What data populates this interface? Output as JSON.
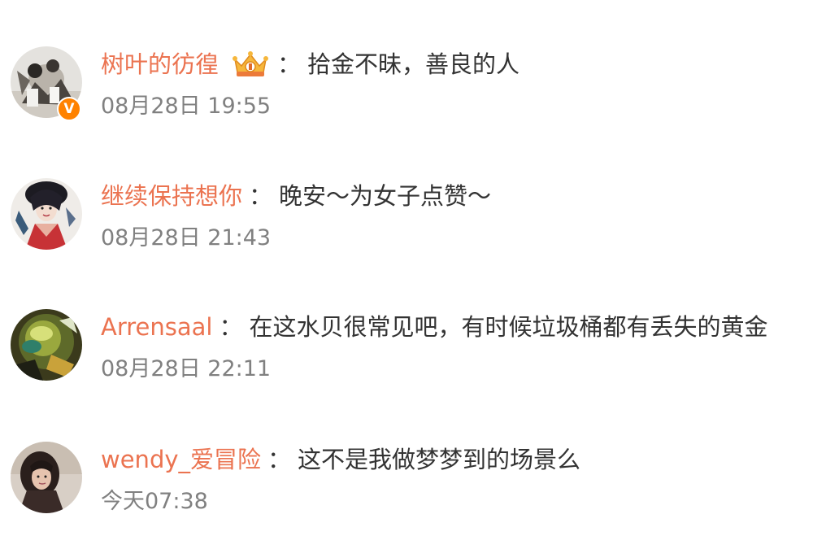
{
  "comments": [
    {
      "username": "树叶的彷徨",
      "colon": "：",
      "text": "拾金不昧，善良的人",
      "time": "08月28日 19:55",
      "verified_badge": "V",
      "verified_icon": "verified-v-icon",
      "member_icon": "crown-member-icon"
    },
    {
      "username": "继续保持想你",
      "colon": "：",
      "text": "晚安～为女子点赞～",
      "time": "08月28日 21:43"
    },
    {
      "username": "Arrensaal",
      "colon": "：",
      "text": "在这水贝很常见吧，有时候垃圾桶都有丢失的黄金",
      "time": "08月28日 22:11"
    },
    {
      "username": "wendy_爱冒险",
      "colon": "：",
      "text": "这不是我做梦梦到的场景么",
      "time": "今天07:38"
    }
  ],
  "colors": {
    "username": "#eb7350",
    "text": "#333333",
    "time": "#808080",
    "verified": "#ff8200"
  }
}
